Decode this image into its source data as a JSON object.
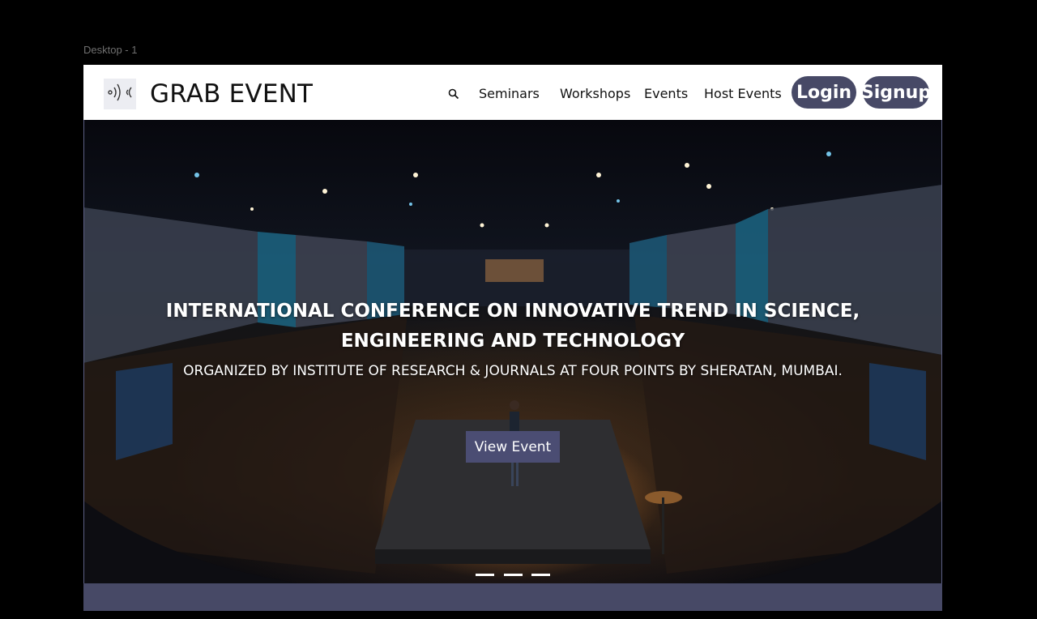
{
  "canvas": {
    "frame_label": "Desktop - 1"
  },
  "header": {
    "brand": "GRAB EVENT",
    "logo_icon": "sound-wave-icon",
    "search_icon": "search-icon",
    "nav": [
      "Seminars",
      "Workshops",
      "Events",
      "Host Events"
    ],
    "login_label": "Login",
    "signup_label": "Signup",
    "accent_color": "#474966"
  },
  "hero": {
    "title_line1": "INTERNATIONAL CONFERENCE ON INNOVATIVE TREND IN SCIENCE,",
    "title_line2": "ENGINEERING AND TECHNOLOGY",
    "subtitle": "ORGANIZED BY INSTITUTE OF RESEARCH & JOURNALS AT FOUR POINTS BY SHERATAN, MUMBAI.",
    "cta_label": "View Event",
    "slides": 3
  },
  "footer": {
    "color": "#474966"
  }
}
